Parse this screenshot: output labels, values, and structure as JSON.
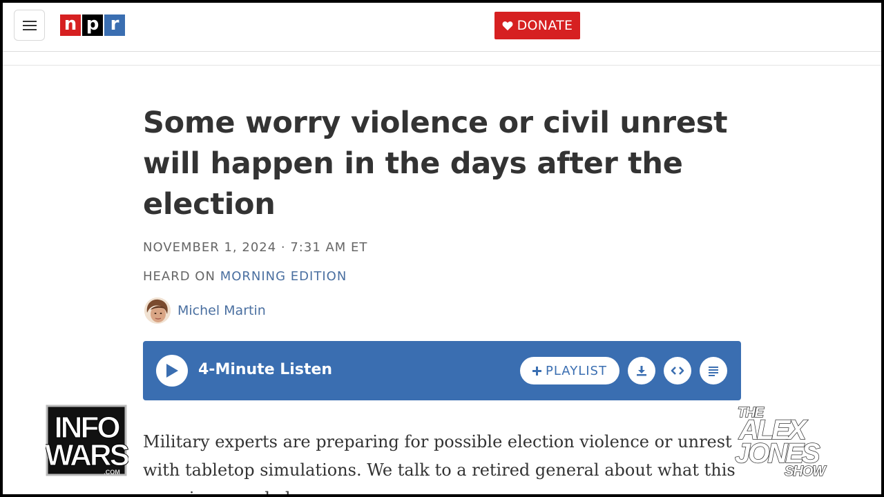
{
  "header": {
    "logo_letters": [
      "n",
      "p",
      "r"
    ],
    "logo_colors": [
      "#d62021",
      "#000000",
      "#3a6eb1"
    ],
    "donate_label": "DONATE",
    "donate_color": "#d62021"
  },
  "article": {
    "headline": "Some worry violence or civil unrest will happen in the days after the election",
    "dateline": "NOVEMBER 1, 2024 · 7:31 AM ET",
    "heard_on_prefix": "HEARD ON",
    "heard_on_program": "MORNING EDITION",
    "author": "Michel Martin",
    "teaser": "Military experts are preparing for possible election violence or unrest with tabletop simulations. We talk to a retired general about what this exercise revealed."
  },
  "player": {
    "listen_label": "4-Minute Listen",
    "playlist_label": "PLAYLIST",
    "accent": "#3a6eb1",
    "icons": [
      "play-icon",
      "plus-icon",
      "download-icon",
      "embed-icon",
      "transcript-icon"
    ]
  },
  "overlays": {
    "left_logo": [
      "INFO",
      "WARS",
      ".COM"
    ],
    "right_logo": [
      "THE",
      "ALEX",
      "JONES",
      "SHOW"
    ]
  }
}
